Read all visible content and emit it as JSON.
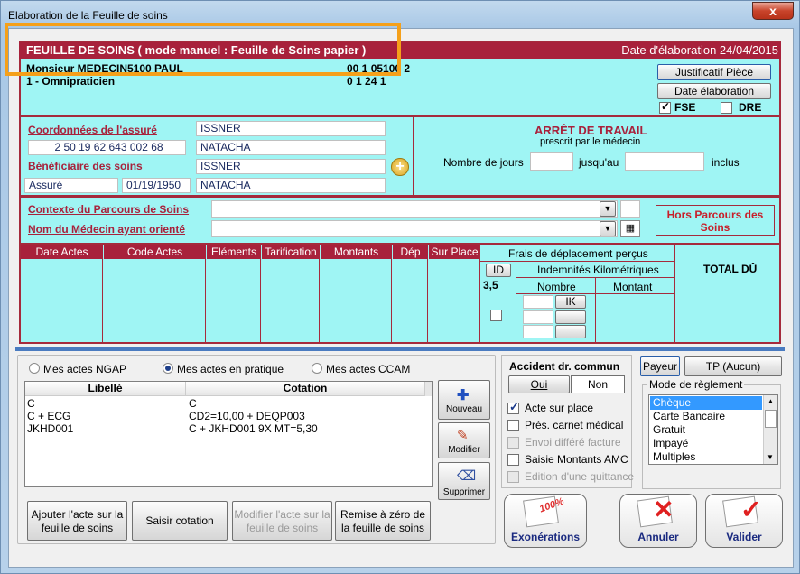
{
  "window": {
    "title": "Elaboration de la Feuille de soins",
    "close": "x"
  },
  "header": {
    "title": "FEUILLE DE SOINS  ( mode manuel : Feuille de Soins papier )",
    "date": "Date d'élaboration 24/04/2015"
  },
  "doctor": {
    "name": "Monsieur MEDECIN5100 PAUL",
    "specialty": "1 - Omnipraticien",
    "code1": "00 1 05100 2",
    "code2": "0 1 24 1"
  },
  "buttons": {
    "justificatif": "Justificatif Pièce",
    "date_elab": "Date élaboration",
    "fse": "FSE",
    "dre": "DRE"
  },
  "insured": {
    "label": "Coordonnées de l'assuré",
    "nir": "2 50 19 62 643 002 68",
    "lastname": "ISSNER",
    "firstname": "NATACHA"
  },
  "beneficiary": {
    "label": "Bénéficiaire des soins",
    "lastname": "ISSNER",
    "firstname": "NATACHA",
    "quality": "Assuré",
    "birthdate": "01/19/1950"
  },
  "arret": {
    "title": "ARRÊT DE TRAVAIL",
    "subtitle": "prescrit par le médecin",
    "days": "Nombre de jours",
    "until": "jusqu'au",
    "inclus": "inclus"
  },
  "parcours": {
    "contexte": "Contexte du Parcours de Soins",
    "medecin": "Nom du Médecin ayant orienté",
    "hors": "Hors Parcours des Soins"
  },
  "grid": {
    "cols": [
      "Date Actes",
      "Code Actes",
      "Eléments",
      "Tarification",
      "Montants",
      "Dép",
      "Sur Place"
    ],
    "frais": "Frais de déplacement perçus",
    "id": "ID",
    "ik_title": "Indemnités Kilométriques",
    "id_val": "3,5",
    "nombre": "Nombre",
    "montant": "Montant",
    "ik": "IK",
    "total": "TOTAL DÛ"
  },
  "actes": {
    "radios": [
      "Mes actes NGAP",
      "Mes actes en pratique",
      "Mes actes CCAM"
    ],
    "col_libelle": "Libellé",
    "col_cotation": "Cotation",
    "rows": [
      {
        "libelle": "C",
        "cotation": "C"
      },
      {
        "libelle": "C + ECG",
        "cotation": "CD2=10,00 + DEQP003"
      },
      {
        "libelle": "JKHD001",
        "cotation": "C + JKHD001  9X  MT=5,30"
      }
    ],
    "nouveau": "Nouveau",
    "modifier": "Modifier",
    "supprimer": "Supprimer",
    "ajouter": "Ajouter l'acte sur la feuille de soins",
    "saisir": "Saisir cotation",
    "modifier_acte": "Modifier l'acte sur la feuille de soins",
    "remise": "Remise à zéro de la feuille de soins"
  },
  "accident": {
    "title": "Accident dr. commun",
    "oui": "Oui",
    "non": "Non"
  },
  "options": [
    {
      "label": "Acte sur place",
      "checked": true,
      "enabled": true
    },
    {
      "label": "Prés. carnet médical",
      "checked": false,
      "enabled": true
    },
    {
      "label": "Envoi différé facture",
      "checked": false,
      "enabled": false
    },
    {
      "label": "Saisie Montants AMC",
      "checked": false,
      "enabled": true
    },
    {
      "label": "Edition d'une quittance",
      "checked": false,
      "enabled": false
    }
  ],
  "payeur": {
    "payeur": "Payeur",
    "tp": "TP (Aucun)"
  },
  "reglement": {
    "title": "Mode de règlement",
    "items": [
      "Chèque",
      "Carte Bancaire",
      "Gratuit",
      "Impayé",
      "Multiples"
    ]
  },
  "actions": {
    "exonerations": "Exonérations",
    "annuler": "Annuler",
    "valider": "Valider",
    "badge": "100%"
  }
}
